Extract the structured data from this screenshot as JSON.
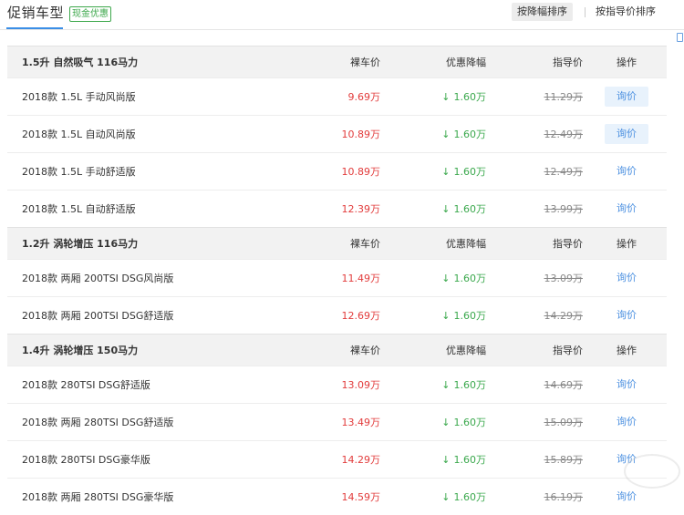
{
  "header": {
    "title": "促销车型",
    "badge": "现金优惠",
    "sort_by_discount": "按降幅排序",
    "sort_by_guide": "按指导价排序"
  },
  "columns": {
    "price": "裸车价",
    "discount": "优惠降幅",
    "guide": "指导价",
    "action": "操作"
  },
  "colors": {
    "price": "#e23c3c",
    "discount": "#3aa84c",
    "link": "#4a8fe0",
    "badge": "#3ea84c"
  },
  "icons": {
    "discount_arrow": "↓"
  },
  "groups": [
    {
      "name": "1.5升 自然吸气 116马力",
      "rows": [
        {
          "name": "2018款 1.5L 手动风尚版",
          "price": "9.69万",
          "discount": "1.60万",
          "guide": "11.29万",
          "action": "询价",
          "highlight": true
        },
        {
          "name": "2018款 1.5L 自动风尚版",
          "price": "10.89万",
          "discount": "1.60万",
          "guide": "12.49万",
          "action": "询价",
          "highlight": true
        },
        {
          "name": "2018款 1.5L 手动舒适版",
          "price": "10.89万",
          "discount": "1.60万",
          "guide": "12.49万",
          "action": "询价",
          "highlight": false
        },
        {
          "name": "2018款 1.5L 自动舒适版",
          "price": "12.39万",
          "discount": "1.60万",
          "guide": "13.99万",
          "action": "询价",
          "highlight": false
        }
      ]
    },
    {
      "name": "1.2升 涡轮增压 116马力",
      "rows": [
        {
          "name": "2018款 两厢 200TSI DSG风尚版",
          "price": "11.49万",
          "discount": "1.60万",
          "guide": "13.09万",
          "action": "询价",
          "highlight": false
        },
        {
          "name": "2018款 两厢 200TSI DSG舒适版",
          "price": "12.69万",
          "discount": "1.60万",
          "guide": "14.29万",
          "action": "询价",
          "highlight": false
        }
      ]
    },
    {
      "name": "1.4升 涡轮增压 150马力",
      "rows": [
        {
          "name": "2018款 280TSI DSG舒适版",
          "price": "13.09万",
          "discount": "1.60万",
          "guide": "14.69万",
          "action": "询价",
          "highlight": false
        },
        {
          "name": "2018款 两厢 280TSI DSG舒适版",
          "price": "13.49万",
          "discount": "1.60万",
          "guide": "15.09万",
          "action": "询价",
          "highlight": false
        },
        {
          "name": "2018款 280TSI DSG豪华版",
          "price": "14.29万",
          "discount": "1.60万",
          "guide": "15.89万",
          "action": "询价",
          "highlight": false
        },
        {
          "name": "2018款 两厢 280TSI DSG豪华版",
          "price": "14.59万",
          "discount": "1.60万",
          "guide": "16.19万",
          "action": "询价",
          "highlight": false
        }
      ]
    }
  ]
}
